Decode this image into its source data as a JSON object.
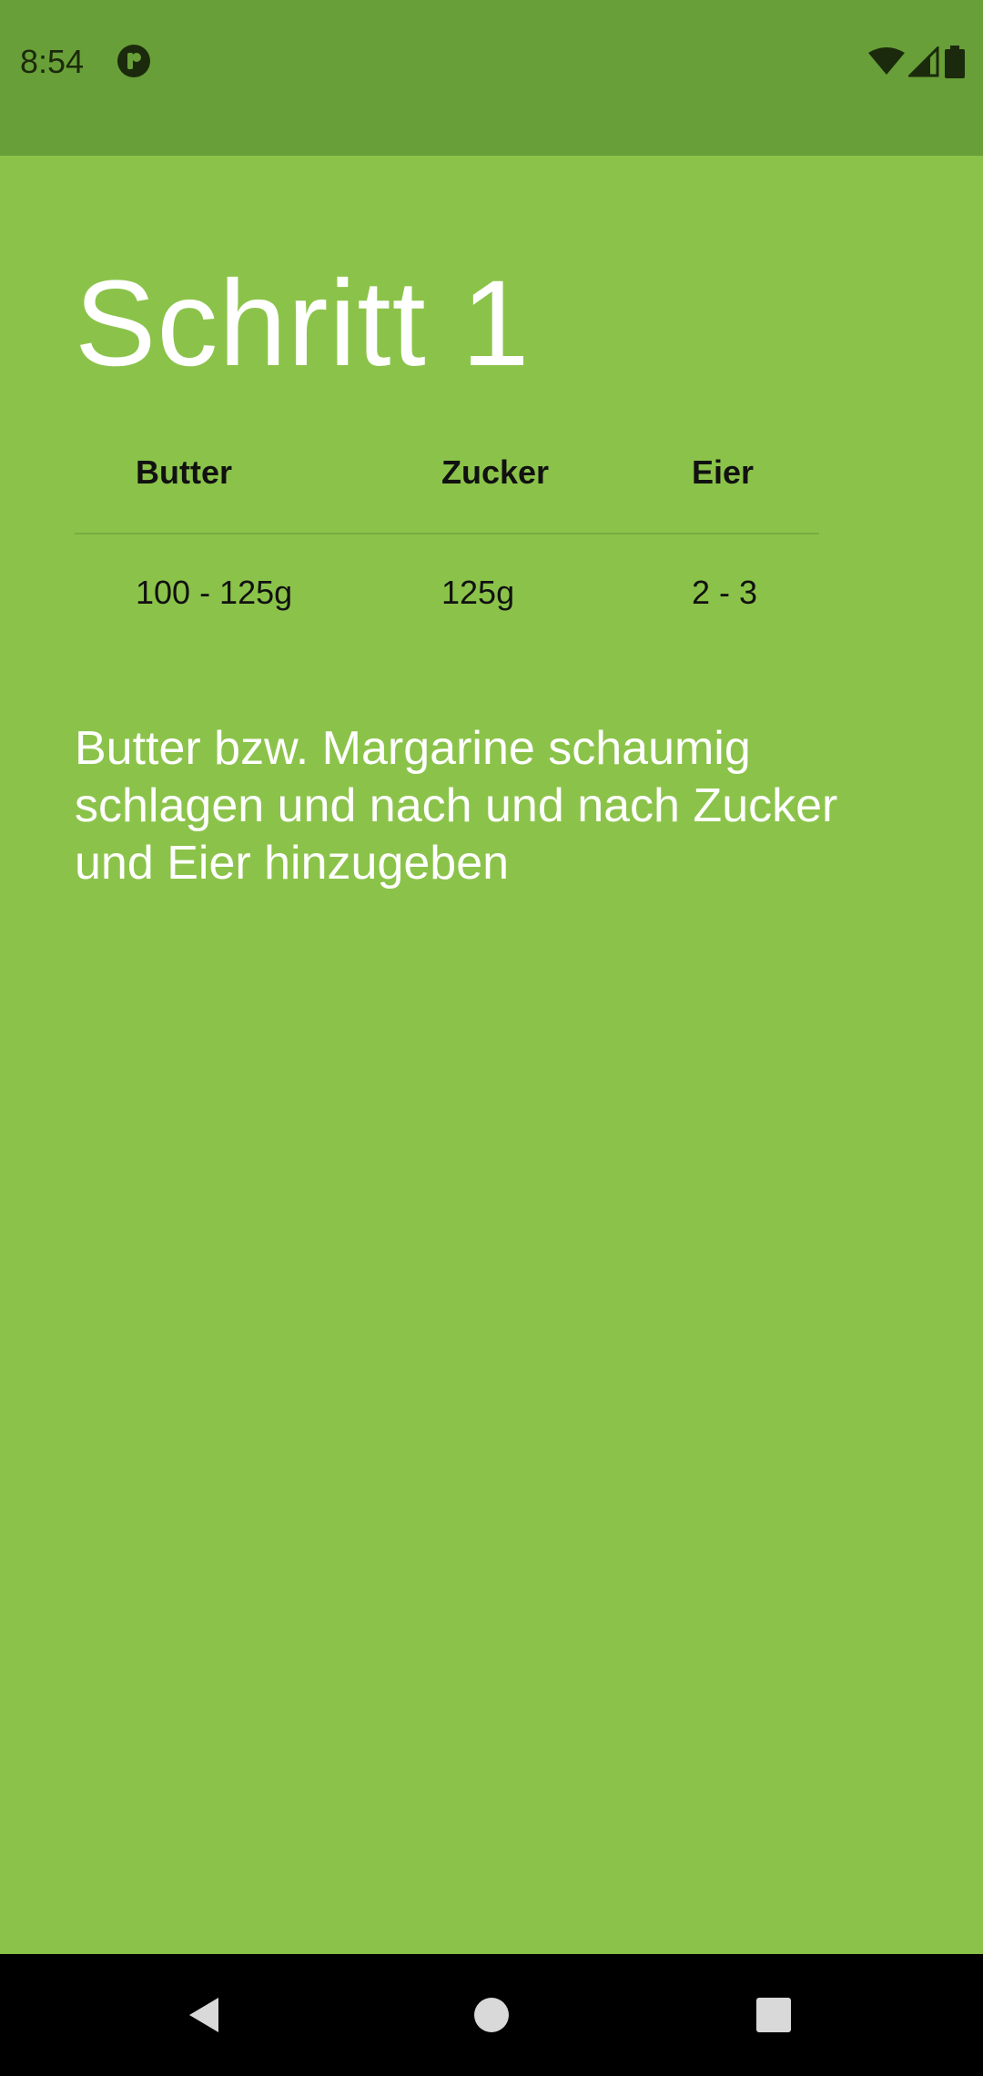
{
  "status_bar": {
    "time": "8:54",
    "app_icon": "notification-app-icon",
    "icons": [
      "wifi-icon",
      "cell-signal-icon",
      "battery-icon"
    ],
    "background": "#689f38"
  },
  "screen": {
    "background": "#8bc34a",
    "title": "Schritt 1",
    "table": {
      "headers": [
        "Butter",
        "Zucker",
        "Eier"
      ],
      "values": [
        "100 - 125g",
        "125g",
        "2 - 3"
      ]
    },
    "description": "Butter bzw. Margarine schaumig schlagen und nach und nach Zucker und Eier hinzugeben"
  },
  "nav_bar": {
    "icons": [
      "back-icon",
      "home-icon",
      "recent-apps-icon"
    ]
  }
}
